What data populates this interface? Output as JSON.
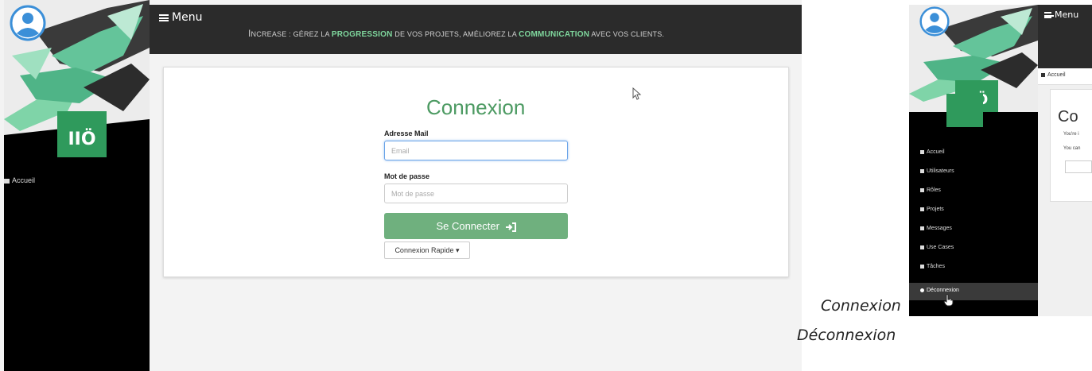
{
  "left": {
    "menu_label": "Menu",
    "tagline": {
      "p1": "I",
      "p2": "NCREASE : ",
      "p3": "GÉREZ LA ",
      "p4": "PROGRESSION",
      "p5": " DE VOS PROJETS, AMÉLIOREZ LA ",
      "p6": "COMMUNICATION",
      "p7": " AVEC VOS CLIENTS."
    },
    "sidebar": {
      "home_label": "Accueil"
    },
    "login": {
      "title": "Connexion",
      "email_label": "Adresse Mail",
      "email_placeholder": "Email",
      "password_label": "Mot de passe",
      "password_placeholder": "Mot de passe",
      "submit_label": "Se Connecter",
      "quick_label": "Connexion Rapide"
    }
  },
  "right": {
    "menu_label": "Menu",
    "breadcrumb": "Accueil",
    "card_title": "Co",
    "card_line1": "You're i",
    "card_line2": "You can",
    "sidebar": [
      {
        "label": "Accueil"
      },
      {
        "label": "Utilisateurs"
      },
      {
        "label": "Rôles"
      },
      {
        "label": "Projets"
      },
      {
        "label": "Messages"
      },
      {
        "label": "Use Cases"
      },
      {
        "label": "Tâches"
      },
      {
        "label": "Déconnexion"
      }
    ]
  },
  "captions": {
    "first": "Connexion",
    "second": "Déconnexion"
  },
  "colors": {
    "accent_green": "#6fb07e",
    "title_green": "#4c9a62",
    "topbar": "#2b2b2b",
    "sidebar": "#000000"
  }
}
